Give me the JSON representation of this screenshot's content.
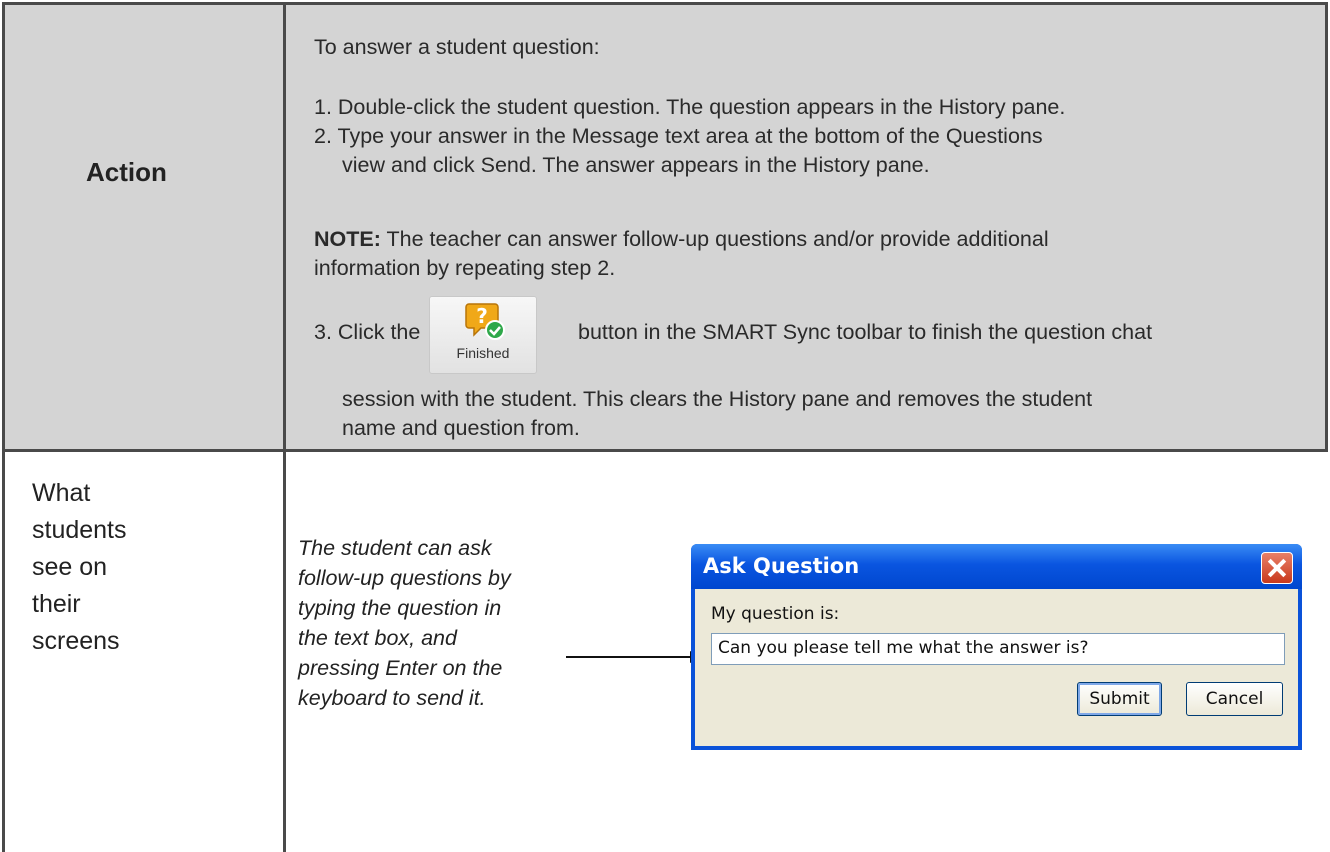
{
  "action": {
    "label": "Action",
    "heading": "To answer a student question:",
    "step1": "1. Double-click the student question. The question appears in the History pane.",
    "step2_line1": "2. Type your answer in the Message text area at the bottom of the Questions",
    "step2_line2_pre": "view and click ",
    "step2_send": "Send",
    "step2_line2_post": ". The answer appears in the History pane.",
    "note_lead": "NOTE:",
    "note_line1": " The teacher can answer follow-up questions and/or provide additional",
    "note_line2": "information by repeating step 2.",
    "step3_pre": "3. Click the",
    "step3_post": "button in the SMART Sync toolbar to finish the question chat",
    "step3_line2": "session with the student. This clears the History pane and removes the student",
    "step3_line3": "name and question from.",
    "finished_button": {
      "label": "Finished",
      "icon": "question-check-icon"
    }
  },
  "students": {
    "label": "What\nstudents\nsee on\ntheir\nscreens",
    "description": "The student can ask\nfollow-up questions by\ntyping the question in\nthe text box, and\npressing Enter on the\nkeyboard to send it."
  },
  "dialog": {
    "title": "Ask Question",
    "prompt": "My question is:",
    "input_value": "Can you please tell me what the answer is?",
    "submit_label": "Submit",
    "cancel_label": "Cancel"
  },
  "colors": {
    "action_row_bg": "#d4d4d4",
    "border": "#4a4a4a",
    "dialog_title": "#0a55e0"
  }
}
